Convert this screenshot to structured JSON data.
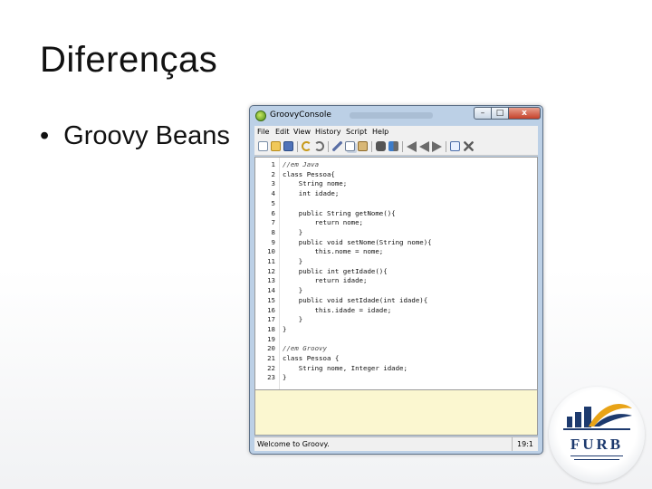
{
  "slide": {
    "title": "Diferenças",
    "bullet_marker": "•",
    "bullet_text": "Groovy Beans"
  },
  "window": {
    "title": "GroovyConsole",
    "buttons": {
      "minimize": "–",
      "maximize": "□",
      "close": "x"
    }
  },
  "menu": [
    "File",
    "Edit",
    "View",
    "History",
    "Script",
    "Help"
  ],
  "toolbar_icons": [
    "new-file-icon",
    "open-icon",
    "save-icon",
    "undo-icon",
    "redo-icon",
    "cut-icon",
    "copy-icon",
    "paste-icon",
    "find-icon",
    "replace-icon",
    "history-previous-icon",
    "history-next-icon",
    "run-icon",
    "interrupt-icon"
  ],
  "editor": {
    "lines": [
      {
        "n": "1",
        "text": "//em Java",
        "comment": true
      },
      {
        "n": "2",
        "text": "class Pessoa{"
      },
      {
        "n": "3",
        "text": "    String nome;"
      },
      {
        "n": "4",
        "text": "    int idade;"
      },
      {
        "n": "5",
        "text": ""
      },
      {
        "n": "6",
        "text": "    public String getNome(){"
      },
      {
        "n": "7",
        "text": "        return nome;"
      },
      {
        "n": "8",
        "text": "    }"
      },
      {
        "n": "9",
        "text": "    public void setNome(String nome){"
      },
      {
        "n": "10",
        "text": "        this.nome = nome;"
      },
      {
        "n": "11",
        "text": "    }"
      },
      {
        "n": "12",
        "text": "    public int getIdade(){"
      },
      {
        "n": "13",
        "text": "        return idade;"
      },
      {
        "n": "14",
        "text": "    }"
      },
      {
        "n": "15",
        "text": "    public void setIdade(int idade){"
      },
      {
        "n": "16",
        "text": "        this.idade = idade;"
      },
      {
        "n": "17",
        "text": "    }"
      },
      {
        "n": "18",
        "text": "}"
      },
      {
        "n": "19",
        "text": ""
      },
      {
        "n": "20",
        "text": "//em Groovy",
        "comment": true
      },
      {
        "n": "21",
        "text": "class Pessoa {"
      },
      {
        "n": "22",
        "text": "    String nome, Integer idade;"
      },
      {
        "n": "23",
        "text": "}"
      }
    ]
  },
  "status": {
    "message": "Welcome to Groovy.",
    "position": "19:1"
  },
  "logo": {
    "text": "FURB",
    "colors": {
      "blue": "#1d3a6e",
      "accent": "#e8a317"
    }
  }
}
